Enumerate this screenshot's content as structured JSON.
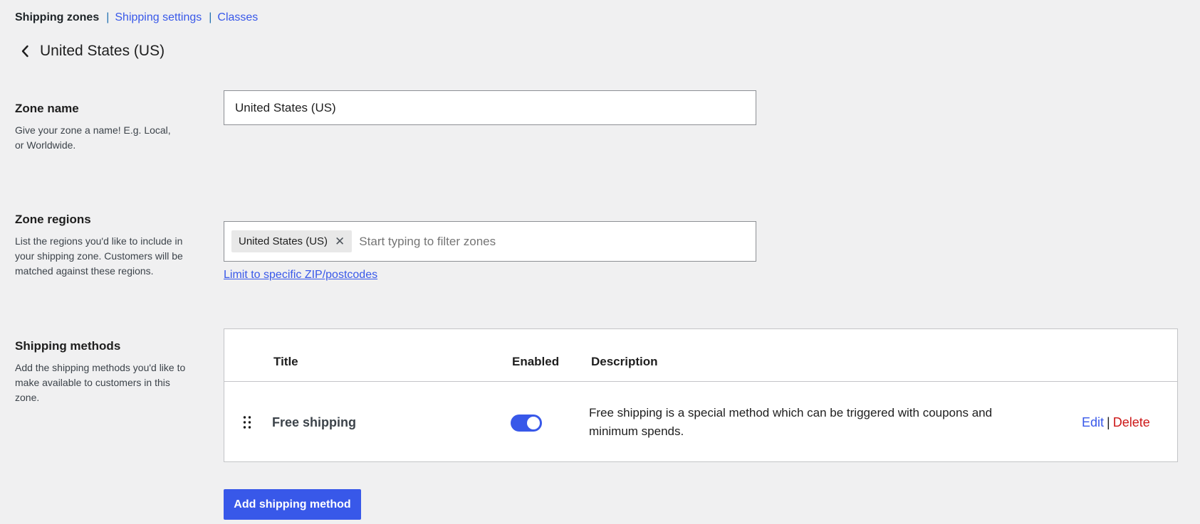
{
  "subnav": {
    "current": "Shipping zones",
    "separator": "|",
    "links": [
      "Shipping settings",
      "Classes"
    ]
  },
  "header": {
    "back_icon": "chevron-left-icon",
    "title": "United States (US)"
  },
  "zone_name": {
    "label": "Zone name",
    "help": "Give your zone a name! E.g. Local, or Worldwide.",
    "value": "United States (US)"
  },
  "zone_regions": {
    "label": "Zone regions",
    "help": "List the regions you'd like to include in your shipping zone. Customers will be matched against these regions.",
    "chips": [
      {
        "label": "United States (US)",
        "remove_icon": "close-icon",
        "remove_glyph": "✕"
      }
    ],
    "placeholder": "Start typing to filter zones",
    "limit_link": "Limit to specific ZIP/postcodes"
  },
  "shipping_methods": {
    "label": "Shipping methods",
    "help": "Add the shipping methods you'd like to make available to customers in this zone.",
    "columns": {
      "title": "Title",
      "enabled": "Enabled",
      "description": "Description"
    },
    "rows": [
      {
        "title": "Free shipping",
        "enabled": true,
        "description": "Free shipping is a special method which can be triggered with coupons and minimum spends.",
        "edit": "Edit",
        "separator": "|",
        "delete": "Delete"
      }
    ],
    "add_button": "Add shipping method"
  },
  "colors": {
    "accent": "#3858e9",
    "delete": "#cc1818",
    "background": "#f0f0f1"
  }
}
